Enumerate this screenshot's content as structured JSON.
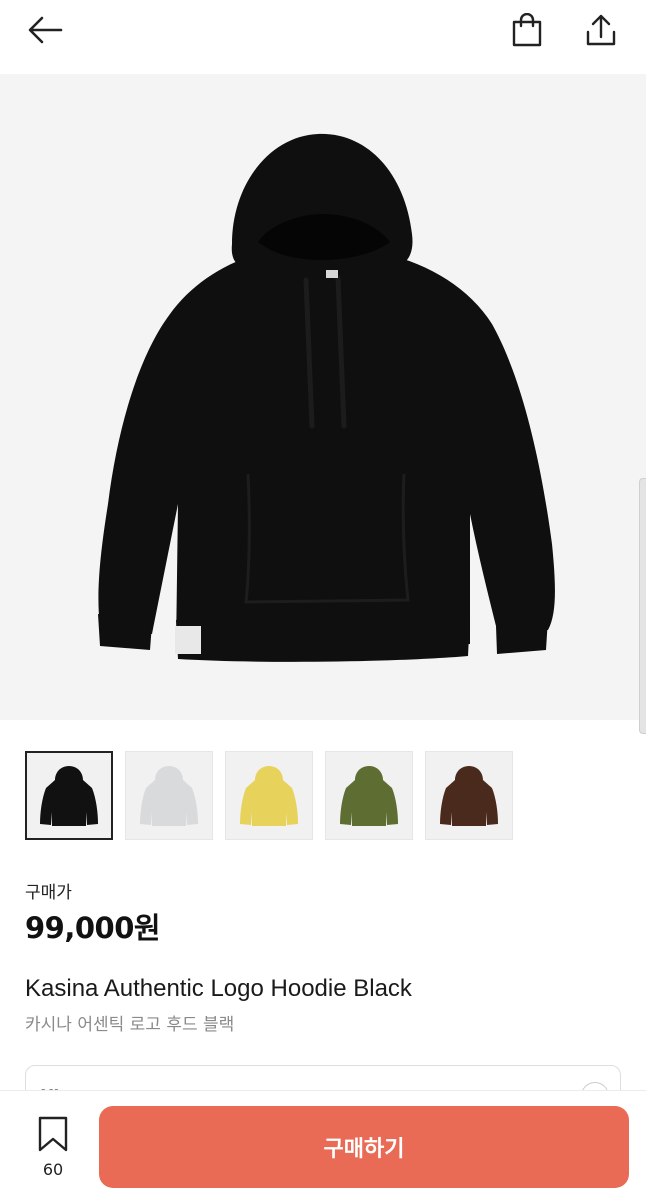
{
  "header": {
    "back_icon": "arrow-left-icon",
    "bag_icon": "shopping-bag-icon",
    "share_icon": "share-upload-icon"
  },
  "product": {
    "image_icon": "hoodie-image",
    "colors": {
      "black": "#111111",
      "gray": "#d9dadc",
      "yellow": "#e7d35b",
      "olive": "#5e6d32",
      "brown": "#4a2a1c"
    },
    "price_label": "구매가",
    "price": "99,000원",
    "name_en": "Kasina Authentic Logo Hoodie Black",
    "name_ko": "카시나 어센틱 로고 후드 블랙"
  },
  "option": {
    "label": "XL"
  },
  "bottom": {
    "bookmark_icon": "bookmark-icon",
    "bookmark_count": "60",
    "buy_label": "구매하기",
    "buy_color": "#ea6b55"
  }
}
